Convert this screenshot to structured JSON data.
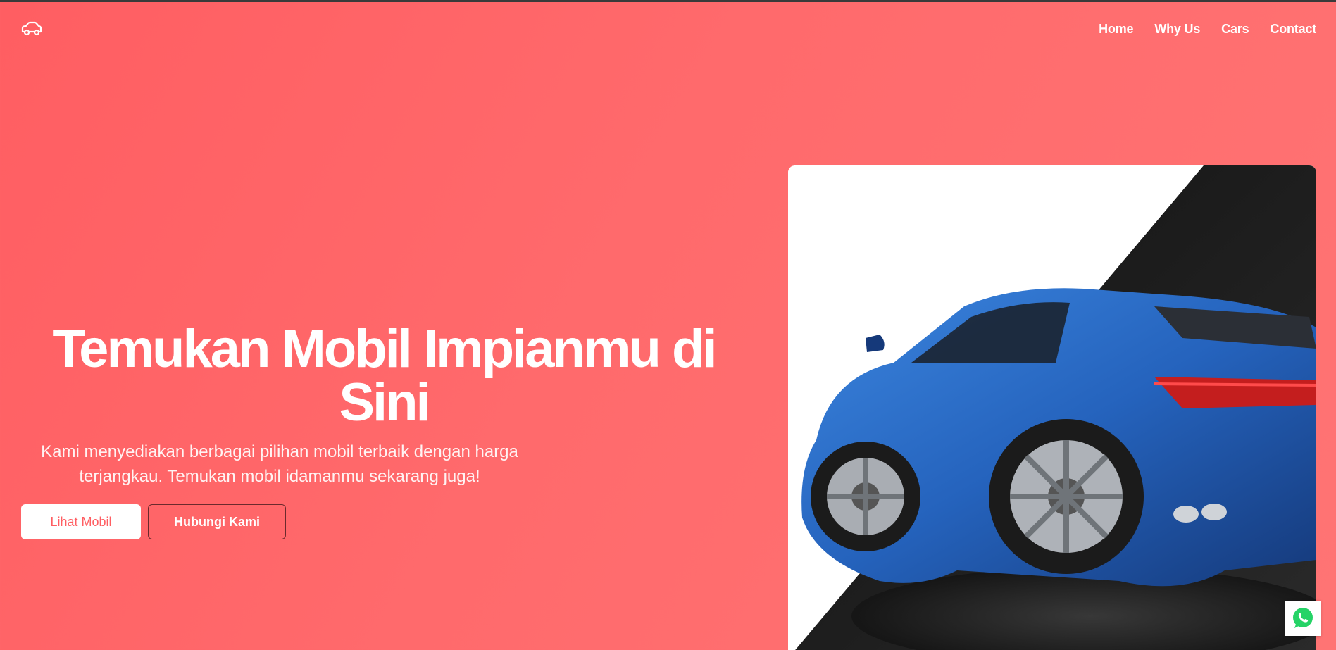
{
  "nav": {
    "logo_icon": "car-icon",
    "links": [
      {
        "label": "Home"
      },
      {
        "label": "Why Us"
      },
      {
        "label": "Cars"
      },
      {
        "label": "Contact"
      }
    ]
  },
  "hero": {
    "title": "Temukan Mobil Impianmu di Sini",
    "subtitle": "Kami menyediakan berbagai pilihan mobil terbaik dengan harga terjangkau. Temukan mobil idamanmu sekarang juga!",
    "primary_button": "Lihat Mobil",
    "secondary_button": "Hubungi Kami",
    "image_icon": "sports-car-image"
  },
  "floating": {
    "whatsapp_icon": "whatsapp-icon"
  },
  "colors": {
    "background": "#ff6567",
    "accent": "#ff5e62",
    "car_body": "#2a6fc9",
    "whatsapp": "#25d366"
  }
}
